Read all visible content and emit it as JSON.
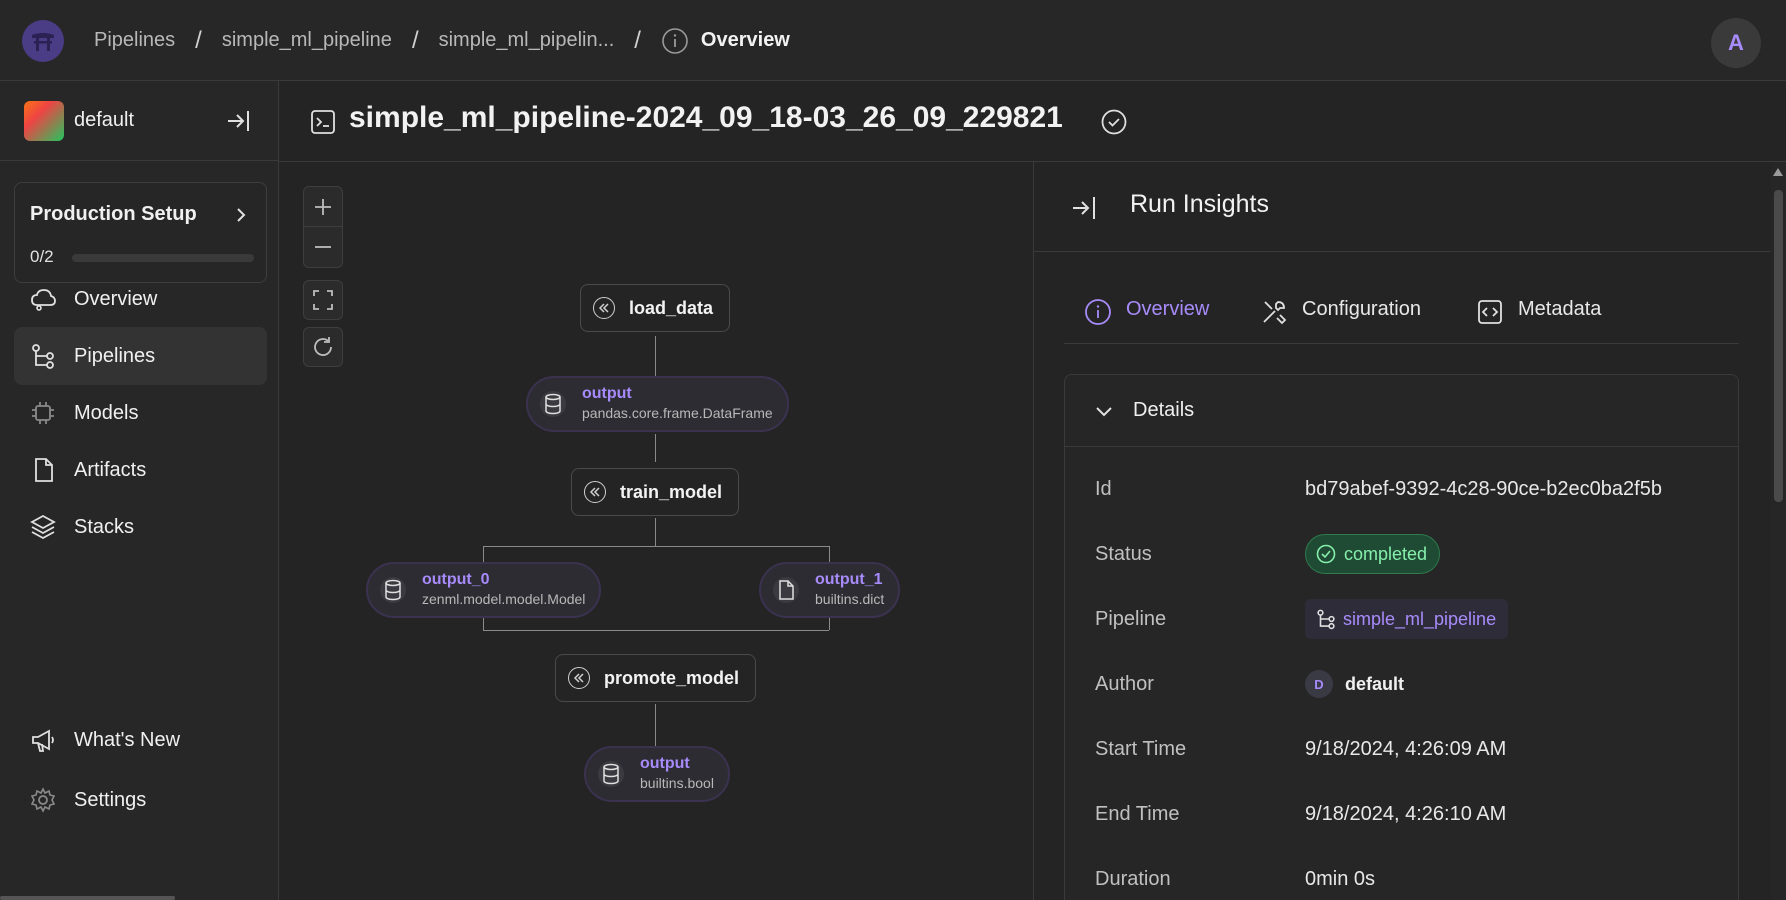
{
  "breadcrumbs": {
    "items": [
      "Pipelines",
      "simple_ml_pipeline",
      "simple_ml_pipelin..."
    ],
    "separator": "/",
    "current": "Overview"
  },
  "user": {
    "avatar_letter": "A"
  },
  "workspace": {
    "name": "default"
  },
  "production_setup": {
    "title": "Production Setup",
    "count": "0/2",
    "progress": 0.0
  },
  "nav": {
    "overview": "Overview",
    "pipelines": "Pipelines",
    "models": "Models",
    "artifacts": "Artifacts",
    "stacks": "Stacks",
    "whats_new": "What's New",
    "settings": "Settings",
    "active": "Pipelines"
  },
  "run": {
    "title": "simple_ml_pipeline-2024_09_18-03_26_09_229821"
  },
  "dag": {
    "steps": {
      "load_data": "load_data",
      "train_model": "train_model",
      "promote_model": "promote_model"
    },
    "artifacts": {
      "load_output": {
        "name": "output",
        "type": "pandas.core.frame.DataFrame",
        "icon": "database-icon"
      },
      "train_output_0": {
        "name": "output_0",
        "type": "zenml.model.model.Model",
        "icon": "database-icon"
      },
      "train_output_1": {
        "name": "output_1",
        "type": "builtins.dict",
        "icon": "file-icon"
      },
      "promote_output": {
        "name": "output",
        "type": "builtins.bool",
        "icon": "database-icon"
      }
    }
  },
  "insights": {
    "title": "Run Insights",
    "tabs": [
      "Overview",
      "Configuration",
      "Metadata"
    ],
    "active_tab": "Overview",
    "details_title": "Details",
    "rows": {
      "id": {
        "label": "Id",
        "value": "bd79abef-9392-4c28-90ce-b2ec0ba2f5b"
      },
      "status": {
        "label": "Status",
        "value": "completed"
      },
      "pipeline": {
        "label": "Pipeline",
        "value": "simple_ml_pipeline"
      },
      "author": {
        "label": "Author",
        "value": "default",
        "initial": "D"
      },
      "start": {
        "label": "Start Time",
        "value": "9/18/2024, 4:26:09 AM"
      },
      "end": {
        "label": "End Time",
        "value": "9/18/2024, 4:26:10 AM"
      },
      "duration": {
        "label": "Duration",
        "value": "0min 0s"
      }
    }
  },
  "colors": {
    "accent": "#a78bfa",
    "success": "#86efac",
    "background": "#242424"
  }
}
